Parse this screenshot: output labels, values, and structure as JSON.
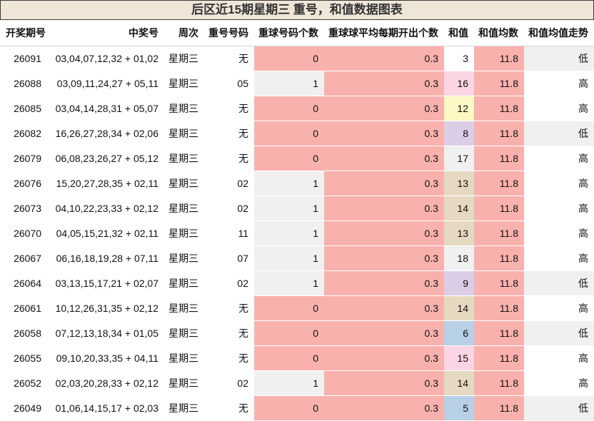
{
  "title": "后区近15期星期三  重号，和值数据图表",
  "headers": [
    "开奖期号",
    "中奖号",
    "周次",
    "重号号码",
    "重球号码个数",
    "重球球平均每期开出个数",
    "和值",
    "和值均数",
    "和值均值走势"
  ],
  "colors": {
    "repeat_zero": "#f9b1ad",
    "repeat_nonzero": "#f0f0f0",
    "avg_col": "#f9b1ad",
    "mean_col": "#f9b1ad",
    "trend_low": "#f0f0f0",
    "trend_high": "#ffffff"
  },
  "rows": [
    {
      "issue": "26091",
      "numbers": "03,04,07,12,32 + 01,02",
      "weekday": "星期三",
      "repeat_nums": "无",
      "repeat_count": "0",
      "avg_repeat": "0.3",
      "sum": "3",
      "sum_color": "#ffffff",
      "sum_mean": "11.8",
      "trend": "低"
    },
    {
      "issue": "26088",
      "numbers": "03,09,11,24,27 + 05,11",
      "weekday": "星期三",
      "repeat_nums": "05",
      "repeat_count": "1",
      "avg_repeat": "0.3",
      "sum": "16",
      "sum_color": "#fbd5e3",
      "sum_mean": "11.8",
      "trend": "高"
    },
    {
      "issue": "26085",
      "numbers": "03,04,14,28,31 + 05,07",
      "weekday": "星期三",
      "repeat_nums": "无",
      "repeat_count": "0",
      "avg_repeat": "0.3",
      "sum": "12",
      "sum_color": "#fdf8c4",
      "sum_mean": "11.8",
      "trend": "高"
    },
    {
      "issue": "26082",
      "numbers": "16,26,27,28,34 + 02,06",
      "weekday": "星期三",
      "repeat_nums": "无",
      "repeat_count": "0",
      "avg_repeat": "0.3",
      "sum": "8",
      "sum_color": "#dccde6",
      "sum_mean": "11.8",
      "trend": "低"
    },
    {
      "issue": "26079",
      "numbers": "06,08,23,26,27 + 05,12",
      "weekday": "星期三",
      "repeat_nums": "无",
      "repeat_count": "0",
      "avg_repeat": "0.3",
      "sum": "17",
      "sum_color": "#f0f0f0",
      "sum_mean": "11.8",
      "trend": "高"
    },
    {
      "issue": "26076",
      "numbers": "15,20,27,28,35 + 02,11",
      "weekday": "星期三",
      "repeat_nums": "02",
      "repeat_count": "1",
      "avg_repeat": "0.3",
      "sum": "13",
      "sum_color": "#e6d9c2",
      "sum_mean": "11.8",
      "trend": "高"
    },
    {
      "issue": "26073",
      "numbers": "04,10,22,23,33 + 02,12",
      "weekday": "星期三",
      "repeat_nums": "02",
      "repeat_count": "1",
      "avg_repeat": "0.3",
      "sum": "14",
      "sum_color": "#e6d9c2",
      "sum_mean": "11.8",
      "trend": "高"
    },
    {
      "issue": "26070",
      "numbers": "04,05,15,21,32 + 02,11",
      "weekday": "星期三",
      "repeat_nums": "11",
      "repeat_count": "1",
      "avg_repeat": "0.3",
      "sum": "13",
      "sum_color": "#e6d9c2",
      "sum_mean": "11.8",
      "trend": "高"
    },
    {
      "issue": "26067",
      "numbers": "06,16,18,19,28 + 07,11",
      "weekday": "星期三",
      "repeat_nums": "07",
      "repeat_count": "1",
      "avg_repeat": "0.3",
      "sum": "18",
      "sum_color": "#f0f0f0",
      "sum_mean": "11.8",
      "trend": "高"
    },
    {
      "issue": "26064",
      "numbers": "03,13,15,17,21 + 02,07",
      "weekday": "星期三",
      "repeat_nums": "02",
      "repeat_count": "1",
      "avg_repeat": "0.3",
      "sum": "9",
      "sum_color": "#dccde6",
      "sum_mean": "11.8",
      "trend": "低"
    },
    {
      "issue": "26061",
      "numbers": "10,12,26,31,35 + 02,12",
      "weekday": "星期三",
      "repeat_nums": "无",
      "repeat_count": "0",
      "avg_repeat": "0.3",
      "sum": "14",
      "sum_color": "#e6d9c2",
      "sum_mean": "11.8",
      "trend": "高"
    },
    {
      "issue": "26058",
      "numbers": "07,12,13,18,34 + 01,05",
      "weekday": "星期三",
      "repeat_nums": "无",
      "repeat_count": "0",
      "avg_repeat": "0.3",
      "sum": "6",
      "sum_color": "#b7d0e6",
      "sum_mean": "11.8",
      "trend": "低"
    },
    {
      "issue": "26055",
      "numbers": "09,10,20,33,35 + 04,11",
      "weekday": "星期三",
      "repeat_nums": "无",
      "repeat_count": "0",
      "avg_repeat": "0.3",
      "sum": "15",
      "sum_color": "#fbd5e3",
      "sum_mean": "11.8",
      "trend": "高"
    },
    {
      "issue": "26052",
      "numbers": "02,03,20,28,33 + 02,12",
      "weekday": "星期三",
      "repeat_nums": "02",
      "repeat_count": "1",
      "avg_repeat": "0.3",
      "sum": "14",
      "sum_color": "#e6d9c2",
      "sum_mean": "11.8",
      "trend": "高"
    },
    {
      "issue": "26049",
      "numbers": "01,06,14,15,17 + 02,03",
      "weekday": "星期三",
      "repeat_nums": "无",
      "repeat_count": "0",
      "avg_repeat": "0.3",
      "sum": "5",
      "sum_color": "#b7d0e6",
      "sum_mean": "11.8",
      "trend": "低"
    }
  ]
}
